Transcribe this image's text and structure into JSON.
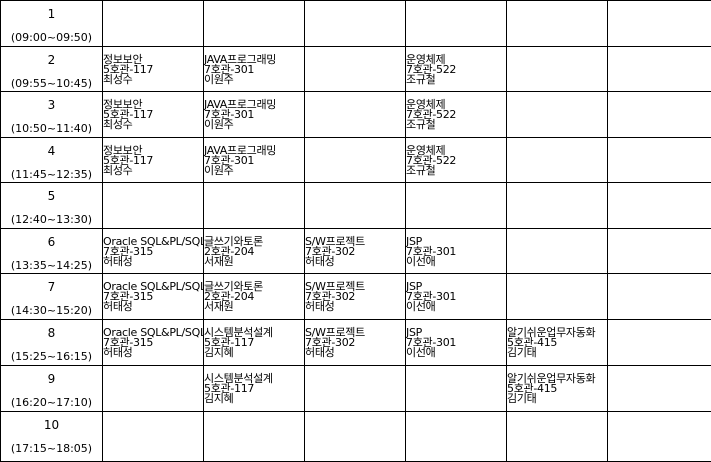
{
  "rows": [
    {
      "period": "1",
      "time": "(09:00~09:50)",
      "cells": [
        null,
        null,
        null,
        null,
        null,
        null
      ]
    },
    {
      "period": "2",
      "time": "(09:55~10:45)",
      "cells": [
        {
          "name": "정보보안",
          "room": "5호관-117",
          "prof": "최성수"
        },
        {
          "name": "JAVA프로그래밍",
          "room": "7호관-301",
          "prof": "이원주"
        },
        null,
        {
          "name": "운영체제",
          "room": "7호관-522",
          "prof": "조규철"
        },
        null,
        null
      ]
    },
    {
      "period": "3",
      "time": "(10:50~11:40)",
      "cells": [
        {
          "name": "정보보안",
          "room": "5호관-117",
          "prof": "최성수"
        },
        {
          "name": "JAVA프로그래밍",
          "room": "7호관-301",
          "prof": "이원주"
        },
        null,
        {
          "name": "운영체제",
          "room": "7호관-522",
          "prof": "조규철"
        },
        null,
        null
      ]
    },
    {
      "period": "4",
      "time": "(11:45~12:35)",
      "cells": [
        {
          "name": "정보보안",
          "room": "5호관-117",
          "prof": "최성수"
        },
        {
          "name": "JAVA프로그래밍",
          "room": "7호관-301",
          "prof": "이원주"
        },
        null,
        {
          "name": "운영체제",
          "room": "7호관-522",
          "prof": "조규철"
        },
        null,
        null
      ]
    },
    {
      "period": "5",
      "time": "(12:40~13:30)",
      "cells": [
        null,
        null,
        null,
        null,
        null,
        null
      ]
    },
    {
      "period": "6",
      "time": "(13:35~14:25)",
      "cells": [
        {
          "name": "Oracle SQL&PL/SQL",
          "room": "7호관-315",
          "prof": "허태성"
        },
        {
          "name": "글쓰기와토론",
          "room": "2호관-204",
          "prof": "서재원"
        },
        {
          "name": "S/W프로젝트",
          "room": "7호관-302",
          "prof": "허태성"
        },
        {
          "name": "JSP",
          "room": "7호관-301",
          "prof": "이선애"
        },
        null,
        null
      ]
    },
    {
      "period": "7",
      "time": "(14:30~15:20)",
      "cells": [
        {
          "name": "Oracle SQL&PL/SQL",
          "room": "7호관-315",
          "prof": "허태성"
        },
        {
          "name": "글쓰기와토론",
          "room": "2호관-204",
          "prof": "서재원"
        },
        {
          "name": "S/W프로젝트",
          "room": "7호관-302",
          "prof": "허태성"
        },
        {
          "name": "JSP",
          "room": "7호관-301",
          "prof": "이선애"
        },
        null,
        null
      ]
    },
    {
      "period": "8",
      "time": "(15:25~16:15)",
      "cells": [
        {
          "name": "Oracle SQL&PL/SQL",
          "room": "7호관-315",
          "prof": "허태성"
        },
        {
          "name": "시스템분석설계",
          "room": "5호관-117",
          "prof": "김지혜"
        },
        {
          "name": "S/W프로젝트",
          "room": "7호관-302",
          "prof": "허태성"
        },
        {
          "name": "JSP",
          "room": "7호관-301",
          "prof": "이선애"
        },
        {
          "name": "알기쉬운업무자동화",
          "room": "5호관-415",
          "prof": "김기태"
        },
        null
      ]
    },
    {
      "period": "9",
      "time": "(16:20~17:10)",
      "cells": [
        null,
        {
          "name": "시스템분석설계",
          "room": "5호관-117",
          "prof": "김지혜"
        },
        null,
        null,
        {
          "name": "알기쉬운업무자동화",
          "room": "5호관-415",
          "prof": "김기태"
        },
        null
      ]
    },
    {
      "period": "10",
      "time": "(17:15~18:05)",
      "cells": [
        null,
        null,
        null,
        null,
        null,
        null
      ]
    }
  ]
}
